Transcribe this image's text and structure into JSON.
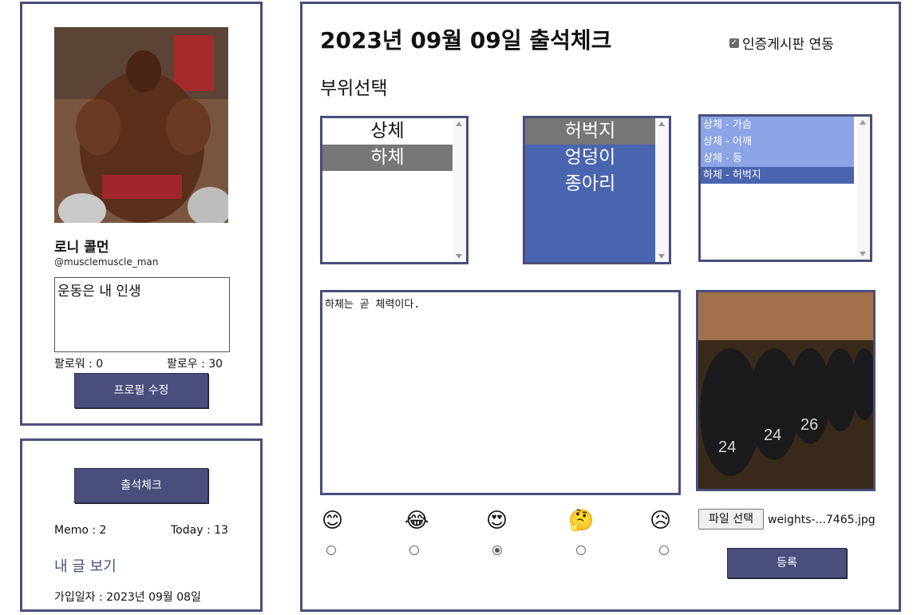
{
  "profile": {
    "name": "로니 콜먼",
    "handle": "@musclemuscle_man",
    "bio": "운동은 내 인생",
    "followers": "팔로워 : 0",
    "following": "팔로우 : 30",
    "edit_button": "프로필 수정"
  },
  "attendance": {
    "button": "출석체크",
    "memo": "Memo : 2",
    "today": "Today : 13",
    "my_posts": "내 글 보기",
    "join_date": "가입일자 : 2023년 09월 08일"
  },
  "main": {
    "title": "2023년 09월 09일 출석체크",
    "sync_label": "인증게시판 연동",
    "section_label": "부위선택",
    "body_parts": [
      "상체",
      "하체"
    ],
    "sub_parts": [
      "허벅지",
      "엉덩이",
      "종아리"
    ],
    "selected_parts": [
      "상체 - 가슴",
      "상체 - 어깨",
      "상체 - 등",
      "하체 - 허벅지"
    ],
    "memo_text": "하체는 곧 체력이다.",
    "moods": [
      "😊",
      "😂",
      "😍",
      "🤔",
      "😥"
    ],
    "selected_mood_index": 2,
    "file_button": "파일 선택",
    "file_name": "weights-...7465.jpg",
    "submit_button": "등록"
  }
}
